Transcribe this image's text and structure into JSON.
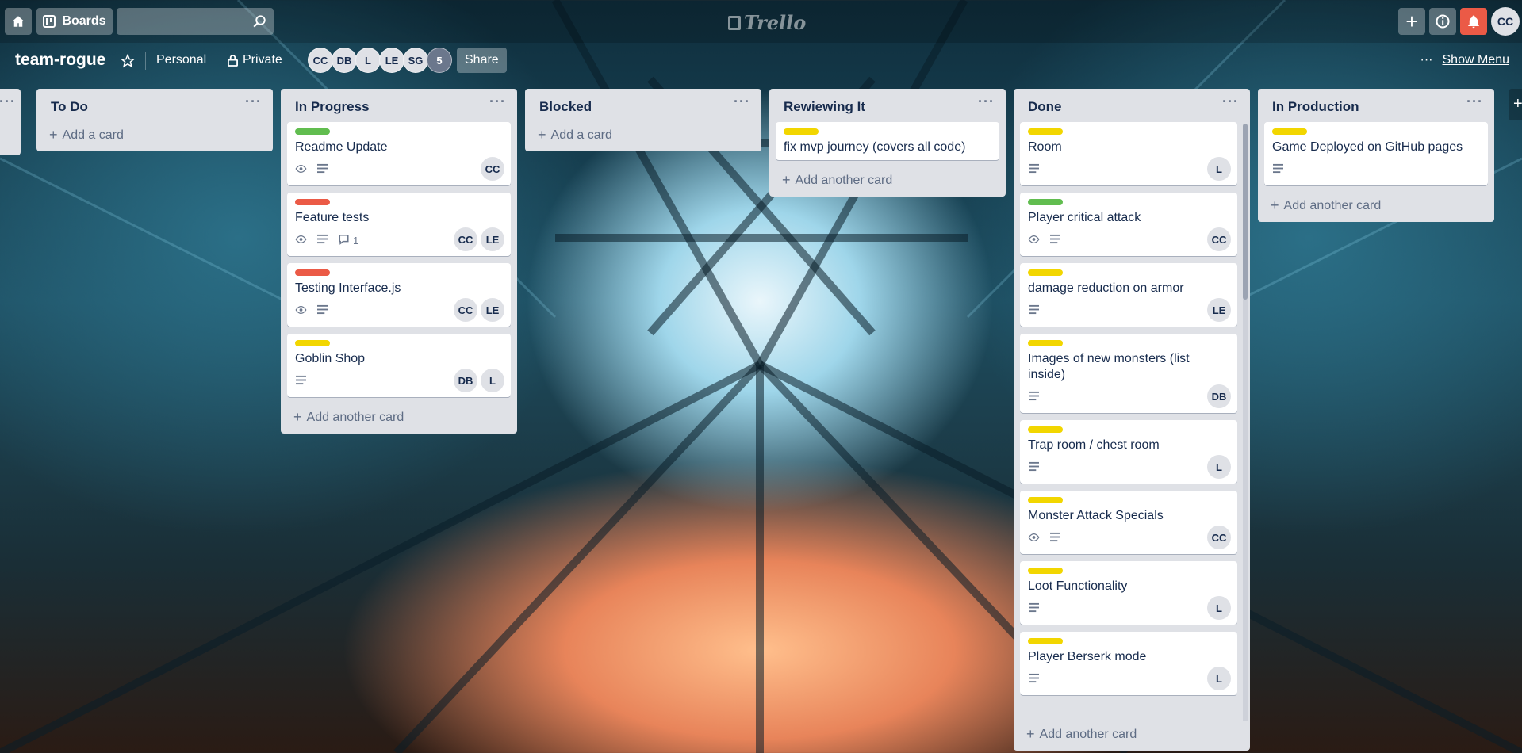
{
  "topbar": {
    "boards_label": "Boards",
    "search_value": "",
    "logo_text": "Trello",
    "user_initials": "CC"
  },
  "board": {
    "title": "team-rogue",
    "team_label": "Personal",
    "visibility_label": "Private",
    "members": [
      "CC",
      "DB",
      "L",
      "LE",
      "SG"
    ],
    "extra_member_count": "5",
    "share_label": "Share",
    "show_menu_label": "Show Menu"
  },
  "colors": {
    "label_green": "#61bd4f",
    "label_red": "#eb5a46",
    "label_yellow": "#f2d600",
    "notification": "#eb5a46"
  },
  "lists": [
    {
      "title": "To Do",
      "cards": [],
      "add_label": "Add a card"
    },
    {
      "title": "In Progress",
      "add_label": "Add another card",
      "cards": [
        {
          "label": "green",
          "title": "Readme Update",
          "badges": [
            "watch",
            "description"
          ],
          "comments": "",
          "members": [
            "CC"
          ]
        },
        {
          "label": "red",
          "title": "Feature tests",
          "badges": [
            "watch",
            "description",
            "comments"
          ],
          "comments": "1",
          "members": [
            "CC",
            "LE"
          ]
        },
        {
          "label": "red",
          "title": "Testing Interface.js",
          "badges": [
            "watch",
            "description"
          ],
          "comments": "",
          "members": [
            "CC",
            "LE"
          ]
        },
        {
          "label": "yellow",
          "title": "Goblin Shop",
          "badges": [
            "description"
          ],
          "comments": "",
          "members": [
            "DB",
            "L"
          ]
        }
      ]
    },
    {
      "title": "Blocked",
      "cards": [],
      "add_label": "Add a card"
    },
    {
      "title": "Rewiewing It",
      "add_label": "Add another card",
      "cards": [
        {
          "label": "yellow",
          "title": "fix mvp journey (covers all code)",
          "badges": [],
          "comments": "",
          "members": []
        }
      ]
    },
    {
      "title": "Done",
      "add_label": "Add another card",
      "cards": [
        {
          "label": "yellow",
          "title": "Room",
          "badges": [
            "description"
          ],
          "comments": "",
          "members": [
            "L"
          ]
        },
        {
          "label": "green",
          "title": "Player critical attack",
          "badges": [
            "watch",
            "description"
          ],
          "comments": "",
          "members": [
            "CC"
          ]
        },
        {
          "label": "yellow",
          "title": "damage reduction on armor",
          "badges": [
            "description"
          ],
          "comments": "",
          "members": [
            "LE"
          ]
        },
        {
          "label": "yellow",
          "title": "Images of new monsters (list inside)",
          "badges": [
            "description"
          ],
          "comments": "",
          "members": [
            "DB"
          ]
        },
        {
          "label": "yellow",
          "title": "Trap room / chest room",
          "badges": [
            "description"
          ],
          "comments": "",
          "members": [
            "L"
          ]
        },
        {
          "label": "yellow",
          "title": "Monster Attack Specials",
          "badges": [
            "watch",
            "description"
          ],
          "comments": "",
          "members": [
            "CC"
          ]
        },
        {
          "label": "yellow",
          "title": "Loot Functionality",
          "badges": [
            "description"
          ],
          "comments": "",
          "members": [
            "L"
          ]
        },
        {
          "label": "yellow",
          "title": "Player Berserk mode",
          "badges": [
            "description"
          ],
          "comments": "",
          "members": [
            "L"
          ]
        }
      ]
    },
    {
      "title": "In Production",
      "add_label": "Add another card",
      "cards": [
        {
          "label": "yellow",
          "title": "Game Deployed on GitHub pages",
          "badges": [
            "description"
          ],
          "comments": "",
          "members": []
        }
      ]
    }
  ]
}
